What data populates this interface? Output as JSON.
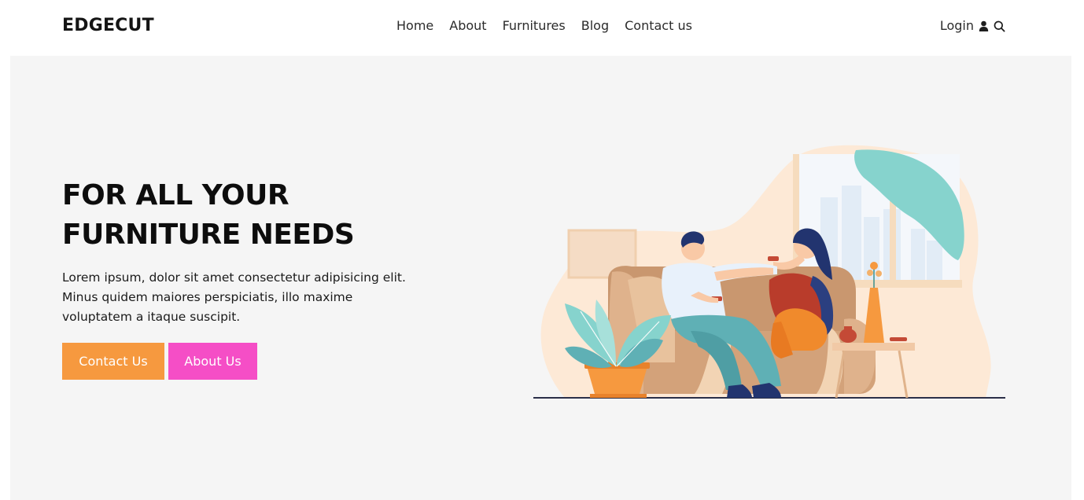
{
  "header": {
    "logo": "EDGECUT",
    "nav": [
      {
        "label": "Home"
      },
      {
        "label": "About"
      },
      {
        "label": "Furnitures"
      },
      {
        "label": "Blog"
      },
      {
        "label": "Contact us"
      }
    ],
    "login_label": "Login",
    "icons": {
      "user": "user-icon",
      "search": "search-icon"
    }
  },
  "hero": {
    "title_lines": [
      "FOR ALL YOUR",
      "FURNITURE NEEDS"
    ],
    "text_lines": [
      "Lorem ipsum, dolor sit amet consectetur adipisicing elit.",
      "Minus quidem maiores perspiciatis, illo maxime",
      "voluptatem a itaque suscipit."
    ],
    "buttons": {
      "contact": "Contact Us",
      "about": "About Us"
    },
    "illustration": "couple-on-sofa-illustration"
  },
  "colors": {
    "hero_bg": "#f5f5f5",
    "contact_button": "#f6993f",
    "about_button": "#f54ec6",
    "text_dark": "#0d0d0d"
  }
}
